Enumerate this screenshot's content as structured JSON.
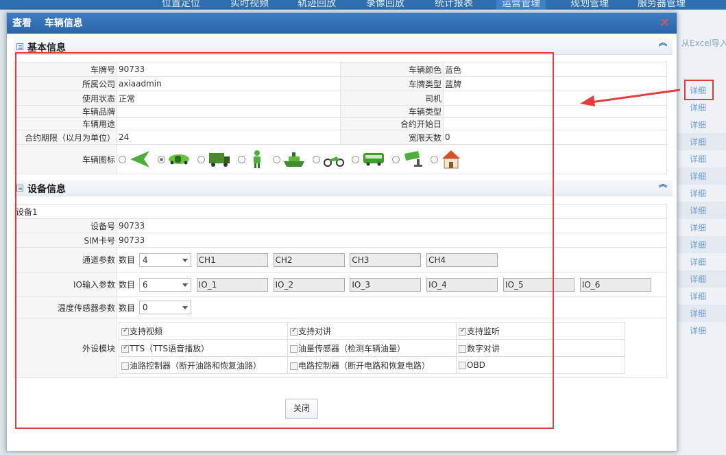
{
  "background": {
    "nav": [
      "位置定位",
      "实时视频",
      "轨迹回放",
      "录像回放",
      "统计报表",
      "运营管理",
      "规划管理",
      "服务器管理"
    ],
    "active_nav_index": 5,
    "import_label": "从Excel导入",
    "row_links": [
      "详细",
      "详细",
      "详细",
      "详细",
      "详细",
      "详细",
      "详细",
      "详细",
      "详细",
      "详细",
      "详细",
      "详细",
      "详细",
      "详细",
      "详细"
    ]
  },
  "dialog": {
    "title_mode": "查看",
    "title": "车辆信息",
    "close_glyph": "✕",
    "close_button": "关闭"
  },
  "basic": {
    "section_title": "基本信息",
    "collapse_glyph": "︽",
    "plate_label": "车牌号",
    "plate": "90733",
    "plate_color_label": "车辆颜色",
    "plate_color": "蓝色",
    "company_label": "所属公司",
    "company": "axiaadmin",
    "plate_type_label": "车牌类型",
    "plate_type": "蓝牌",
    "status_label": "使用状态",
    "status": "正常",
    "driver_label": "司机",
    "driver": "",
    "brand_label": "车辆品牌",
    "brand": "",
    "vehicle_type_label": "车辆类型",
    "vehicle_type": "",
    "usage_label": "车辆用途",
    "usage": "",
    "contract_start_label": "合约开始日",
    "contract_start": "",
    "contract_term_label": "合约期限（以月为单位）",
    "contract_term": "24",
    "grace_label": "宽限天数",
    "grace": "0",
    "icon_label": "车辆图标",
    "icons": [
      "arrow-icon",
      "sports-car-icon",
      "truck-icon",
      "person-icon",
      "ship-icon",
      "motorcycle-icon",
      "bus-icon",
      "camera-icon",
      "house-icon"
    ],
    "selected_icon_index": 1
  },
  "device": {
    "section_title": "设备信息",
    "collapse_glyph": "︽",
    "group_title": "设备1",
    "device_no_label": "设备号",
    "device_no": "90733",
    "sim_label": "SIM卡号",
    "sim": "90733",
    "channel_label": "通道参数",
    "count_label": "数目",
    "channel_count": "4",
    "channels": [
      "CH1",
      "CH2",
      "CH3",
      "CH4"
    ],
    "io_label": "IO输入参数",
    "io_count": "6",
    "io": [
      "IO_1",
      "IO_2",
      "IO_3",
      "IO_4",
      "IO_5",
      "IO_6"
    ],
    "temp_label": "温度传感器参数",
    "temp_count": "0",
    "periph_label": "外设模块",
    "peripherals": [
      [
        {
          "label": "支持视频",
          "checked": true
        },
        {
          "label": "支持对讲",
          "checked": true
        },
        {
          "label": "支持监听",
          "checked": true
        }
      ],
      [
        {
          "label": "TTS（TTS语音播放）",
          "checked": true
        },
        {
          "label": "油量传感器（检测车辆油量）",
          "checked": false
        },
        {
          "label": "数字对讲",
          "checked": false
        }
      ],
      [
        {
          "label": "油路控制器（断开油路和恢复油路）",
          "checked": false
        },
        {
          "label": "电路控制器（断开电路和恢复电路）",
          "checked": false
        },
        {
          "label": "OBD",
          "checked": false
        }
      ]
    ]
  },
  "colors": {
    "title_bar": "#2c64a6",
    "highlight": "#e53b3b",
    "link": "#6c9bd2"
  }
}
